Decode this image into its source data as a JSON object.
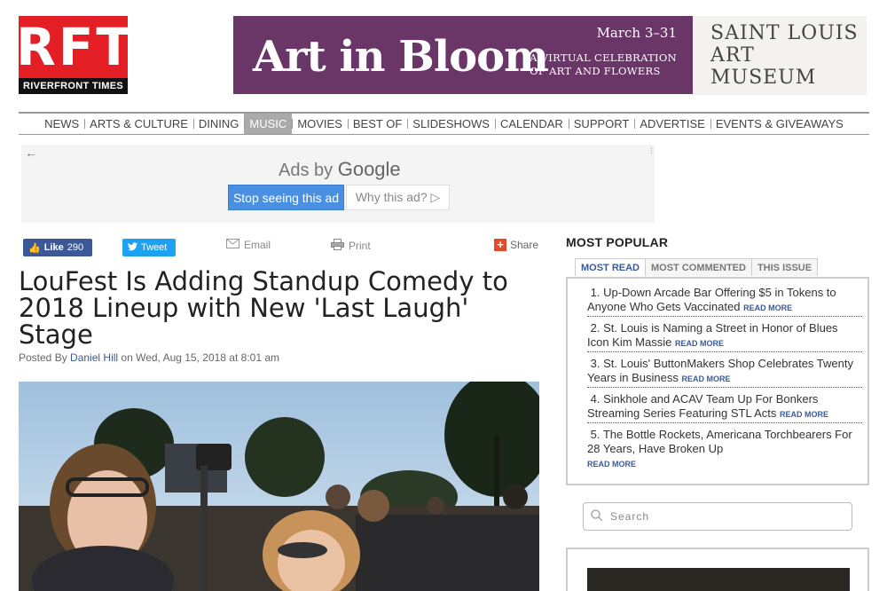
{
  "logo": {
    "letters": [
      "R",
      "F",
      "T"
    ],
    "tagline": "RIVERFRONT TIMES"
  },
  "banner": {
    "date": "March 3–31",
    "title": "Art in Bloom",
    "subtitle_line1": "A VIRTUAL CELEBRATION",
    "subtitle_line2": "OF ART AND FLOWERS",
    "museum_line1": "SAINT LOUIS",
    "museum_line2": "ART MUSEUM",
    "color": "#6a3567"
  },
  "nav": {
    "items": [
      "NEWS",
      "ARTS & CULTURE",
      "DINING",
      "MUSIC",
      "MOVIES",
      "BEST OF",
      "SLIDESHOWS",
      "CALENDAR",
      "SUPPORT",
      "ADVERTISE",
      "EVENTS & GIVEAWAYS"
    ],
    "active": "MUSIC"
  },
  "ad": {
    "title_prefix": "Ads by",
    "title_brand": "Google",
    "stop_label": "Stop seeing this ad",
    "why_label": "Why this ad? ▷"
  },
  "share": {
    "like_label": "Like",
    "like_count": "290",
    "tweet_label": "Tweet",
    "email_label": "Email",
    "print_label": "Print",
    "share_label": "Share"
  },
  "article": {
    "headline": "LouFest Is Adding Standup Comedy to 2018 Lineup with New 'Last Laugh' Stage",
    "byline_prefix": "Posted By",
    "author": "Daniel Hill",
    "byline_suffix": "on Wed, Aug 15, 2018 at 8:01 am"
  },
  "most_popular": {
    "title": "MOST POPULAR",
    "tabs": [
      "MOST READ",
      "MOST COMMENTED",
      "THIS ISSUE"
    ],
    "read_more": "READ MORE",
    "items": [
      {
        "num": "1.",
        "text": "Up-Down Arcade Bar Offering $5 in Tokens to Anyone Who Gets Vaccinated"
      },
      {
        "num": "2.",
        "text": "St. Louis is Naming a Street in Honor of Blues Icon Kim Massie"
      },
      {
        "num": "3.",
        "text": "St. Louis' ButtonMakers Shop Celebrates Twenty Years in Business"
      },
      {
        "num": "4.",
        "text": "Sinkhole and ACAV Team Up For Bonkers Streaming Series Featuring STL Acts"
      },
      {
        "num": "5.",
        "text": "The Bottle Rockets, Americana Torchbearers For 28 Years, Have Broken Up"
      }
    ]
  },
  "search": {
    "placeholder": "Search"
  },
  "colors": {
    "brand_red": "#e31e24",
    "link_blue": "#3a5a9a",
    "facebook": "#3b5998",
    "twitter": "#1da1f2"
  }
}
